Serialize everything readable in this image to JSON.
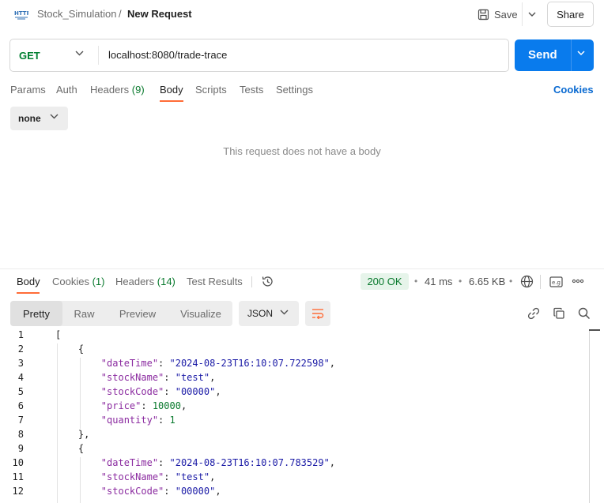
{
  "header": {
    "collection": "Stock_Simulation",
    "separator": "/",
    "title": "New Request",
    "save_label": "Save",
    "share_label": "Share"
  },
  "request": {
    "method": "GET",
    "url": "localhost:8080/trade-trace",
    "send_label": "Send",
    "tabs": [
      {
        "label": "Params"
      },
      {
        "label": "Auth"
      },
      {
        "label": "Headers",
        "count": "(9)"
      },
      {
        "label": "Body",
        "active": true
      },
      {
        "label": "Scripts"
      },
      {
        "label": "Tests"
      },
      {
        "label": "Settings"
      }
    ],
    "cookies_label": "Cookies",
    "body_type": "none",
    "empty_body_text": "This request does not have a body"
  },
  "response": {
    "tabs": [
      {
        "label": "Body",
        "active": true
      },
      {
        "label": "Cookies",
        "count": "(1)"
      },
      {
        "label": "Headers",
        "count": "(14)"
      },
      {
        "label": "Test Results"
      }
    ],
    "status": "200 OK",
    "time": "41 ms",
    "size": "6.65 KB",
    "view_modes": [
      "Pretty",
      "Raw",
      "Preview",
      "Visualize"
    ],
    "active_view": "Pretty",
    "format": "JSON"
  },
  "code": {
    "line_numbers": [
      "1",
      "2",
      "3",
      "4",
      "5",
      "6",
      "7",
      "8",
      "9",
      "10",
      "11",
      "12"
    ],
    "lines": [
      [
        {
          "t": "p",
          "v": "["
        }
      ],
      [
        {
          "t": "p",
          "v": "    {"
        }
      ],
      [
        {
          "t": "p",
          "v": "        "
        },
        {
          "t": "k",
          "v": "\"dateTime\""
        },
        {
          "t": "p",
          "v": ": "
        },
        {
          "t": "s",
          "v": "\"2024-08-23T16:10:07.722598\""
        },
        {
          "t": "p",
          "v": ","
        }
      ],
      [
        {
          "t": "p",
          "v": "        "
        },
        {
          "t": "k",
          "v": "\"stockName\""
        },
        {
          "t": "p",
          "v": ": "
        },
        {
          "t": "s",
          "v": "\"test\""
        },
        {
          "t": "p",
          "v": ","
        }
      ],
      [
        {
          "t": "p",
          "v": "        "
        },
        {
          "t": "k",
          "v": "\"stockCode\""
        },
        {
          "t": "p",
          "v": ": "
        },
        {
          "t": "s",
          "v": "\"00000\""
        },
        {
          "t": "p",
          "v": ","
        }
      ],
      [
        {
          "t": "p",
          "v": "        "
        },
        {
          "t": "k",
          "v": "\"price\""
        },
        {
          "t": "p",
          "v": ": "
        },
        {
          "t": "n",
          "v": "10000"
        },
        {
          "t": "p",
          "v": ","
        }
      ],
      [
        {
          "t": "p",
          "v": "        "
        },
        {
          "t": "k",
          "v": "\"quantity\""
        },
        {
          "t": "p",
          "v": ": "
        },
        {
          "t": "n",
          "v": "1"
        }
      ],
      [
        {
          "t": "p",
          "v": "    },"
        }
      ],
      [
        {
          "t": "p",
          "v": "    {"
        }
      ],
      [
        {
          "t": "p",
          "v": "        "
        },
        {
          "t": "k",
          "v": "\"dateTime\""
        },
        {
          "t": "p",
          "v": ": "
        },
        {
          "t": "s",
          "v": "\"2024-08-23T16:10:07.783529\""
        },
        {
          "t": "p",
          "v": ","
        }
      ],
      [
        {
          "t": "p",
          "v": "        "
        },
        {
          "t": "k",
          "v": "\"stockName\""
        },
        {
          "t": "p",
          "v": ": "
        },
        {
          "t": "s",
          "v": "\"test\""
        },
        {
          "t": "p",
          "v": ","
        }
      ],
      [
        {
          "t": "p",
          "v": "        "
        },
        {
          "t": "k",
          "v": "\"stockCode\""
        },
        {
          "t": "p",
          "v": ": "
        },
        {
          "t": "s",
          "v": "\"00000\""
        },
        {
          "t": "p",
          "v": ","
        }
      ]
    ]
  },
  "colors": {
    "accent": "#ff6c37",
    "send": "#097bed",
    "method_get": "#007f31",
    "status_ok": "#0a7a2e",
    "json_key": "#8b2ba0",
    "json_string": "#1a1aa6"
  },
  "icons": [
    "http-icon",
    "save-icon",
    "chevron-down-icon",
    "history-icon",
    "globe-icon",
    "example-icon",
    "more-icon",
    "wrap-icon",
    "link-icon",
    "copy-icon",
    "search-icon"
  ]
}
